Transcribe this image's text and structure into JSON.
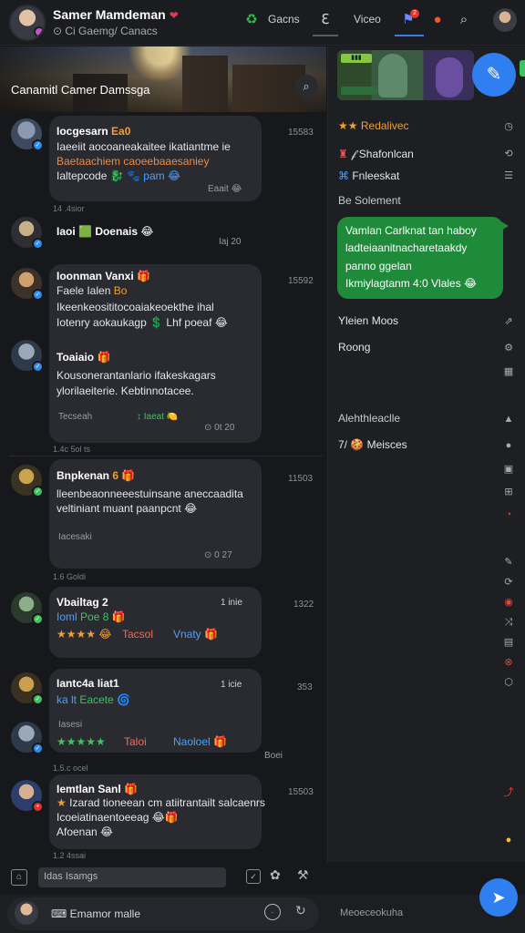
{
  "topbar": {
    "user_name": "Samer Mamdeman",
    "heart": "❤",
    "status": "Ci Gaemg/ Canacs",
    "tab_games": "Gacns",
    "tab_videos": "Viceo",
    "notif_count": "2"
  },
  "hero": {
    "title": "Canamitl Camer Damssga"
  },
  "messages": [
    {
      "name": "Iocgesarn",
      "name_extra": "Ea0",
      "time": "15583",
      "lines": [
        "Iaeeiit aocoaneakaitee ikatiantme ie",
        "Baetaachiem caoeebaaesaniey",
        "Ialtepcode",
        "pam 😂"
      ],
      "line3_icons": "🐉 🐾",
      "meta": "Eaait 😂"
    },
    {
      "day": "14 .4sior",
      "name": "Iaoi",
      "name_extra": "Doenais 😂",
      "icon": "🟩",
      "meta": "Iaj  20"
    },
    {
      "name": "Ioonman Vanxi",
      "name_extra": "🎁",
      "time": "15592",
      "lines": [
        "Faele Ialen",
        "Ikeenkeosititocoaiakeoekthe ihal",
        "Iotenry aokaukagp",
        "Lhf poeaf 😂"
      ],
      "line1_extra": "Bo"
    },
    {
      "name": "Toaiaio",
      "name_extra": "🎁",
      "lines": [
        "Kousonerantanlario ifakeskagars",
        "ylorilaeiterie.  Kebtinnotacee."
      ],
      "meta_left": "Tecseah",
      "meta_mid": "Iaeat",
      "time": "0t  20"
    },
    {
      "day": "1.4c 5ol  ts",
      "name": "Bnpkenan",
      "name_extra": "6 🎁",
      "time": "11503",
      "lines": [
        "lleenbeaonneeestuinsane aneccaadita",
        "veltiniant  muant  paanpcnt 😂"
      ],
      "meta_left": "Iacesaki",
      "meta_right": "0  27"
    },
    {
      "day": "1.6 Goldi",
      "name": "Vbailtag",
      "name_extra": "2",
      "badge_text": "1 inie",
      "time": "1322",
      "line1": "Ioml",
      "line1_b": "Poe 8 🎁",
      "rating": "★★★★",
      "tag1": "Tacsol",
      "tag2": "Vnaty 🎁"
    },
    {
      "name": "Iantc4a",
      "name_extra": "Iiat1",
      "badge_text": "1 icie",
      "time": "353",
      "line1": "ka lt",
      "line1_b": "Eacete",
      "sub": "Iasesi",
      "rating": "★★★★★",
      "tag1": "Taloi",
      "tag2": "Naoloel 🎁",
      "meta": "Boei"
    },
    {
      "day": "1.5.c ocel",
      "name": "Iemtlan",
      "name_extra": "Sanl 🎁",
      "time": "15503",
      "lines": [
        "Izarad tioneean cm atiitrantailt salcaenrs",
        "Icoeiatinaentoeeag 😂🎁",
        "Afoenan 😂"
      ]
    },
    {
      "day": "1.2  4ssai"
    }
  ],
  "input": {
    "placeholder": "Idas Isamgs"
  },
  "composer": {
    "label": "Emamor malle",
    "right": "Meoeceokuha"
  },
  "right": {
    "items_top": [
      "Redalivec",
      "Shafonlcan",
      "Fnleeskat"
    ],
    "section1": "Be Solement",
    "green_lines": [
      "Vamlan  Carlknat tan haboy",
      "ladteiaanitnacharetaakdy",
      "panno  ggelan",
      "Ikmiylagtanm 4:0  Vlales 😂"
    ],
    "items_mid": [
      "Yleien Moos",
      "Roong"
    ],
    "section2": "Alehthleaclle",
    "items_bottom": [
      "Meisces"
    ]
  },
  "colors": {
    "accent_blue": "#2f7ff0",
    "bubble": "#2a2b30",
    "green_bubble": "#1f8b3a",
    "orange": "#f0a030"
  }
}
